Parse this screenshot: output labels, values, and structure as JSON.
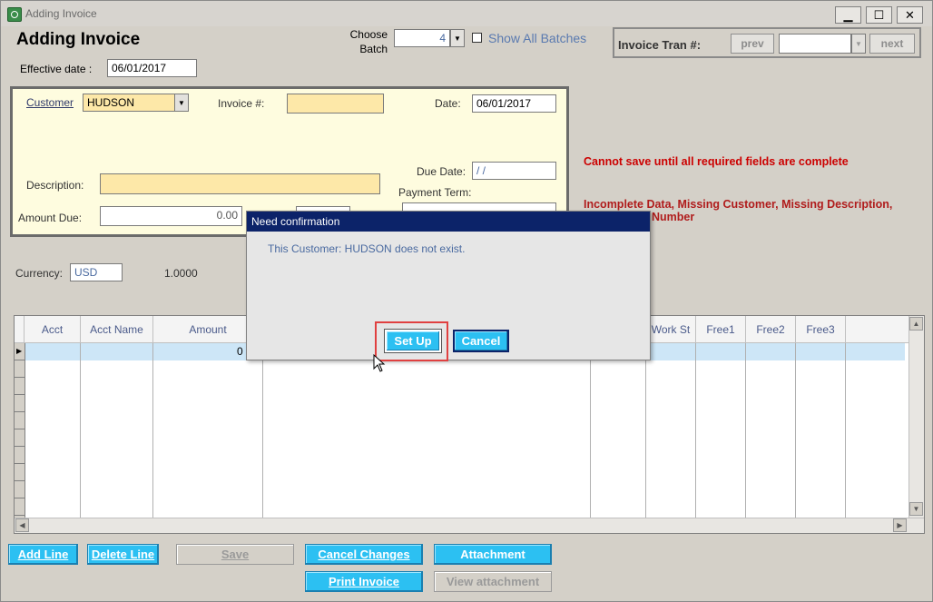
{
  "window": {
    "title": "Adding Invoice",
    "minimize": "▁",
    "maximize": "☐",
    "close": "✕"
  },
  "header": {
    "page_title": "Adding Invoice",
    "choose_batch_label_1": "Choose",
    "choose_batch_label_2": "Batch",
    "batch_value": "4",
    "show_all_batches": "Show All Batches",
    "invoice_tran_label": "Invoice Tran #:",
    "prev_label": "prev",
    "next_label": "next",
    "effective_date_label": "Effective date :",
    "effective_date_value": "06/01/2017"
  },
  "form": {
    "customer_label": "Customer",
    "customer_value": "HUDSON",
    "invoice_no_label": "Invoice #:",
    "invoice_no_value": "",
    "date_label": "Date:",
    "date_value": "06/01/2017",
    "due_date_label": "Due Date:",
    "due_date_value": " /  /",
    "payment_term_label": "Payment Term:",
    "description_label": "Description:",
    "description_value": "",
    "amount_due_label": "Amount Due:",
    "amount_due_value": "0.00",
    "currency_label": "Currency:",
    "currency_value": "USD",
    "exchange_rate": "1.0000"
  },
  "messages": {
    "cannot_save": "Cannot save until all required fields are complete",
    "incomplete_1": "Incomplete Data, Missing Customer, Missing Description,",
    "incomplete_2": "Number"
  },
  "grid": {
    "columns": [
      "Acct",
      "Acct Name",
      "Amount",
      "Work St",
      "Free1",
      "Free2",
      "Free3"
    ],
    "first_row_amount": "0"
  },
  "buttons": {
    "add_line": "Add Line",
    "delete_line": "Delete Line",
    "save": "Save",
    "cancel_changes": "Cancel Changes",
    "attachment": "Attachment",
    "print_invoice": "Print Invoice",
    "view_attachment": "View attachment"
  },
  "dialog": {
    "title": "Need confirmation",
    "message": "This Customer: HUDSON does not exist.",
    "setup_label": "Set Up",
    "cancel_label": "Cancel"
  },
  "colors": {
    "accent": "#2cc0f2",
    "dialog_title": "#0c2369",
    "error": "#cc0000",
    "required_field": "#fde8a8"
  }
}
